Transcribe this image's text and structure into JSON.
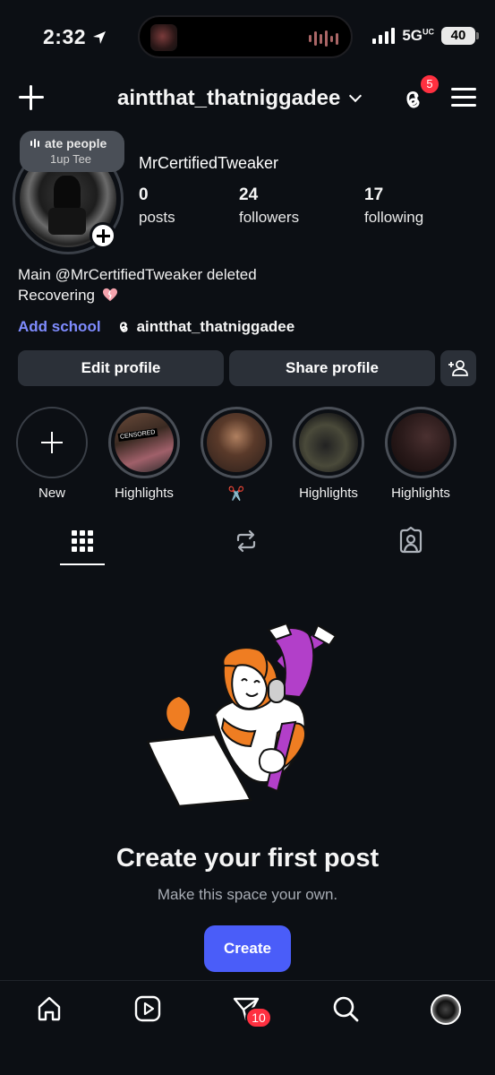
{
  "status_bar": {
    "time": "2:32",
    "network": "5G",
    "network_sup": "UC",
    "battery": "40"
  },
  "header": {
    "username": "aintthat_thatniggadee",
    "threads_badge": "5"
  },
  "note": {
    "line1": "ate people",
    "line2": "1up Tee"
  },
  "profile": {
    "display_name": "MrCertifiedTweaker",
    "stats": [
      {
        "num": "0",
        "label": "posts"
      },
      {
        "num": "24",
        "label": "followers"
      },
      {
        "num": "17",
        "label": "following"
      }
    ],
    "bio_line1": "Main @MrCertifiedTweaker deleted",
    "bio_line2": "Recovering",
    "add_school": "Add school",
    "threads_handle": "aintthat_thatniggadee"
  },
  "buttons": {
    "edit": "Edit profile",
    "share": "Share profile"
  },
  "highlights": [
    {
      "label": "New"
    },
    {
      "label": "Highlights",
      "badge_text": "CENSORED"
    },
    {
      "label": "✂️"
    },
    {
      "label": "Highlights"
    },
    {
      "label": "Highlights"
    }
  ],
  "empty_state": {
    "title": "Create your first post",
    "subtitle": "Make this space your own.",
    "button": "Create"
  },
  "bottom_nav": {
    "dm_badge": "10"
  },
  "colors": {
    "background": "#0c0f14",
    "accent": "#4a5df9",
    "link": "#7f8cff",
    "badge": "#ff3040"
  }
}
